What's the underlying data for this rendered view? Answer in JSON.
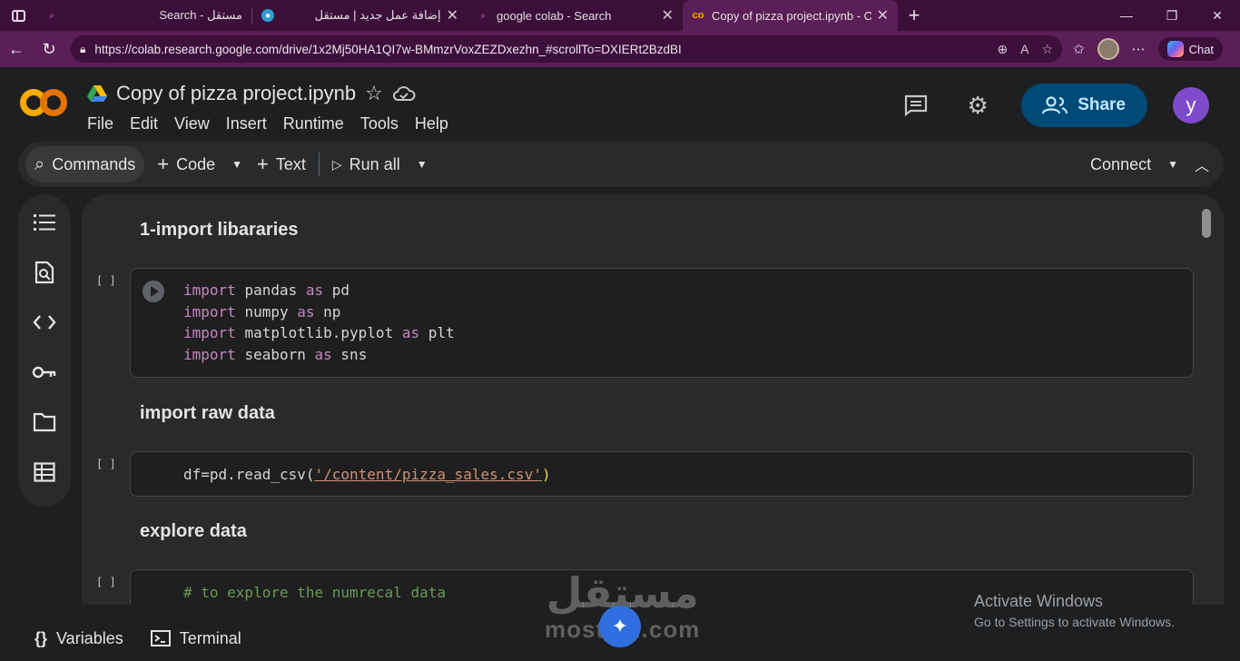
{
  "browser": {
    "tabs": [
      {
        "title": "مستقل - Search",
        "rtl": true
      },
      {
        "title": "إضافة عمل جديد | مستقل",
        "rtl": true
      },
      {
        "title": "google colab - Search",
        "rtl": false
      },
      {
        "title": "Copy of pizza project.ipynb - Colab",
        "rtl": false,
        "active": true
      }
    ],
    "url": "https://colab.research.google.com/drive/1x2Mj50HA1QI7w-BMmzrVoxZEZDxezhn_#scrollTo=DXIERt2BzdBI",
    "chat_label": "Chat"
  },
  "colab": {
    "notebook_title": "Copy of pizza project.ipynb",
    "menu": [
      "File",
      "Edit",
      "View",
      "Insert",
      "Runtime",
      "Tools",
      "Help"
    ],
    "share_label": "Share",
    "user_initial": "y",
    "toolbar": {
      "commands": "Commands",
      "code": "Code",
      "text": "Text",
      "run_all": "Run all",
      "connect": "Connect"
    },
    "cells": [
      {
        "heading": "1-import libararies"
      },
      {
        "exec": "[ ]",
        "lines": [
          [
            "import",
            "pandas",
            "as",
            "pd"
          ],
          [
            "import",
            "numpy",
            "as",
            "np"
          ],
          [
            "import",
            "matplotlib.pyplot",
            "as",
            "plt"
          ],
          [
            "import",
            "seaborn",
            "as",
            "sns"
          ]
        ]
      },
      {
        "heading": "import raw data"
      },
      {
        "exec": "[ ]",
        "prefix": "df=pd.read_csv(",
        "string": "'/content/pizza_sales.csv'",
        "suffix": ")"
      },
      {
        "heading": "explore data"
      },
      {
        "exec": "[ ]",
        "comment": "# to explore the numrecal data"
      }
    ],
    "bottom": {
      "variables": "Variables",
      "terminal": "Terminal"
    }
  },
  "overlay": {
    "watermark_ar": "مستقل",
    "watermark_lat": "mostaql.com",
    "activate_title": "Activate Windows",
    "activate_sub": "Go to Settings to activate Windows."
  },
  "colors": {
    "share_bg": "#004a77",
    "avatar_bg": "#7f4bcc",
    "keyword": "#c586c0",
    "string": "#ce9178",
    "comment": "#6a9955"
  }
}
